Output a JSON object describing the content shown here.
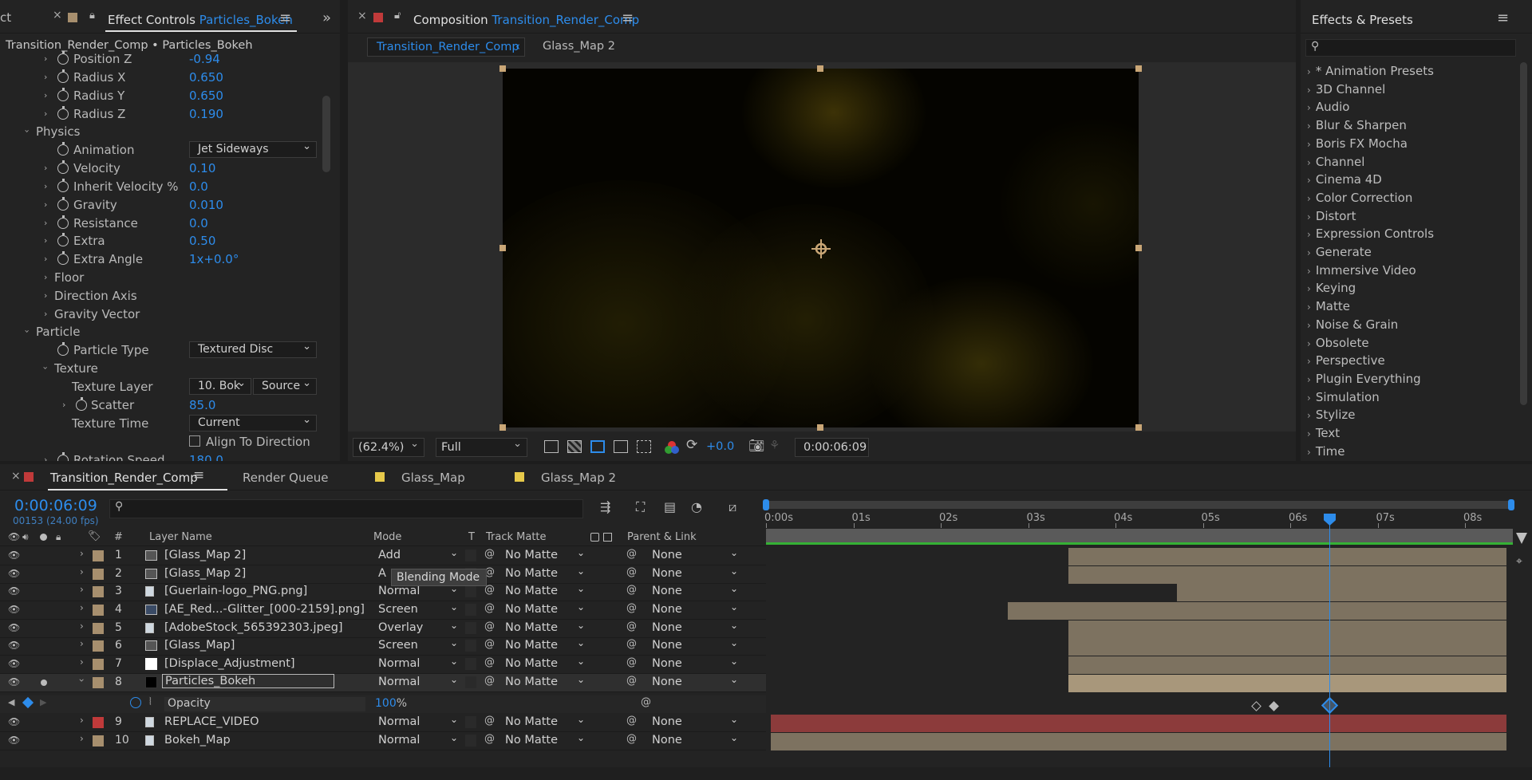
{
  "effect_controls": {
    "cut_tab": "ct",
    "tab_title": "Effect Controls",
    "tab_layer": "Particles_Bokeh",
    "breadcrumb": "Transition_Render_Comp • Particles_Bokeh",
    "rows": [
      {
        "label": "Position Z",
        "value": "-0.94"
      },
      {
        "label": "Radius X",
        "value": "0.650"
      },
      {
        "label": "Radius Y",
        "value": "0.650"
      },
      {
        "label": "Radius Z",
        "value": "0.190"
      },
      {
        "label": "Physics",
        "value": ""
      },
      {
        "label": "Animation",
        "value": "Jet Sideways"
      },
      {
        "label": "Velocity",
        "value": "0.10"
      },
      {
        "label": "Inherit Velocity %",
        "value": "0.0"
      },
      {
        "label": "Gravity",
        "value": "0.010"
      },
      {
        "label": "Resistance",
        "value": "0.0"
      },
      {
        "label": "Extra",
        "value": "0.50"
      },
      {
        "label": "Extra Angle",
        "value": "1x+0.0°"
      },
      {
        "label": "Floor",
        "value": ""
      },
      {
        "label": "Direction Axis",
        "value": ""
      },
      {
        "label": "Gravity Vector",
        "value": ""
      },
      {
        "label": "Particle",
        "value": ""
      },
      {
        "label": "Particle Type",
        "value": "Textured Disc"
      },
      {
        "label": "Texture",
        "value": ""
      },
      {
        "label": "Texture Layer",
        "value": "10. Bok",
        "value2": "Source"
      },
      {
        "label": "Scatter",
        "value": "85.0"
      },
      {
        "label": "Texture Time",
        "value": "Current"
      },
      {
        "label": "Align To Direction",
        "value": ""
      },
      {
        "label": "Rotation Speed",
        "value": "180.0"
      }
    ]
  },
  "composition": {
    "tab_title": "Composition",
    "tab_comp": "Transition_Render_Comp",
    "nav_active": "Transition_Render_Comp",
    "nav_other": "Glass_Map 2",
    "zoom": "(62.4%)",
    "resolution": "Full",
    "exposure": "+0.0",
    "timecode": "0:00:06:09"
  },
  "effects_presets": {
    "title": "Effects & Presets",
    "search_placeholder": "",
    "items": [
      "* Animation Presets",
      "3D Channel",
      "Audio",
      "Blur & Sharpen",
      "Boris FX Mocha",
      "Channel",
      "Cinema 4D",
      "Color Correction",
      "Distort",
      "Expression Controls",
      "Generate",
      "Immersive Video",
      "Keying",
      "Matte",
      "Noise & Grain",
      "Obsolete",
      "Perspective",
      "Plugin Everything",
      "Simulation",
      "Stylize",
      "Text",
      "Time"
    ]
  },
  "timeline": {
    "tabs": [
      {
        "label": "Transition_Render_Comp",
        "color": "#c03a3a"
      },
      {
        "label": "Render Queue",
        "color": ""
      },
      {
        "label": "Glass_Map",
        "color": "#e6c94a"
      },
      {
        "label": "Glass_Map 2",
        "color": "#e6c94a"
      }
    ],
    "timecode": "0:00:06:09",
    "frames": "00153 (24.00 fps)",
    "headers": {
      "num": "#",
      "layer_name": "Layer Name",
      "mode": "Mode",
      "t": "T",
      "track_matte": "Track Matte",
      "parent": "Parent & Link"
    },
    "ruler": [
      "0:00s",
      "01s",
      "02s",
      "03s",
      "04s",
      "05s",
      "06s",
      "07s",
      "08s"
    ],
    "tooltip": "Blending Mode",
    "opacity_label": "Opacity",
    "opacity_value": "100",
    "opacity_unit": "%",
    "layers": [
      {
        "num": "1",
        "name": "[Glass_Map 2]",
        "mode": "Add",
        "matte": "No Matte",
        "parent": "None",
        "label_color": "#a78f6e",
        "icon": "comp",
        "bar_start": 0.405,
        "bar_end": 1.0
      },
      {
        "num": "2",
        "name": "[Glass_Map 2]",
        "mode": "A",
        "matte": "No Matte",
        "parent": "None",
        "label_color": "#a78f6e",
        "icon": "comp",
        "bar_start": 0.405,
        "bar_end": 1.0
      },
      {
        "num": "3",
        "name": "[Guerlain-logo_PNG.png]",
        "mode": "Normal",
        "matte": "No Matte",
        "parent": "None",
        "label_color": "#a78f6e",
        "icon": "file",
        "bar_start": 0.552,
        "bar_end": 1.0
      },
      {
        "num": "4",
        "name": "[AE_Red...-Glitter_[000-2159].png]",
        "mode": "Screen",
        "matte": "No Matte",
        "parent": "None",
        "label_color": "#a78f6e",
        "icon": "seq",
        "bar_start": 0.322,
        "bar_end": 1.0
      },
      {
        "num": "5",
        "name": "[AdobeStock_565392303.jpeg]",
        "mode": "Overlay",
        "matte": "No Matte",
        "parent": "None",
        "label_color": "#a78f6e",
        "icon": "file",
        "bar_start": 0.405,
        "bar_end": 1.0
      },
      {
        "num": "6",
        "name": "[Glass_Map]",
        "mode": "Screen",
        "matte": "No Matte",
        "parent": "None",
        "label_color": "#a78f6e",
        "icon": "comp",
        "bar_start": 0.405,
        "bar_end": 1.0
      },
      {
        "num": "7",
        "name": "[Displace_Adjustment]",
        "mode": "Normal",
        "matte": "No Matte",
        "parent": "None",
        "label_color": "#a78f6e",
        "icon": "solid-white",
        "bar_start": 0.405,
        "bar_end": 1.0
      },
      {
        "num": "8",
        "name": "Particles_Bokeh",
        "mode": "Normal",
        "matte": "No Matte",
        "parent": "None",
        "label_color": "#a78f6e",
        "icon": "solid-black",
        "bar_start": 0.405,
        "bar_end": 1.0
      },
      {
        "num": "9",
        "name": "REPLACE_VIDEO",
        "mode": "Normal",
        "matte": "No Matte",
        "parent": "None",
        "label_color": "#c03a3a",
        "icon": "file",
        "bar_start": 0.0,
        "bar_end": 1.0
      },
      {
        "num": "10",
        "name": "Bokeh_Map",
        "mode": "Normal",
        "matte": "No Matte",
        "parent": "None",
        "label_color": "#a78f6e",
        "icon": "file",
        "bar_start": 0.0,
        "bar_end": 1.0
      }
    ]
  }
}
